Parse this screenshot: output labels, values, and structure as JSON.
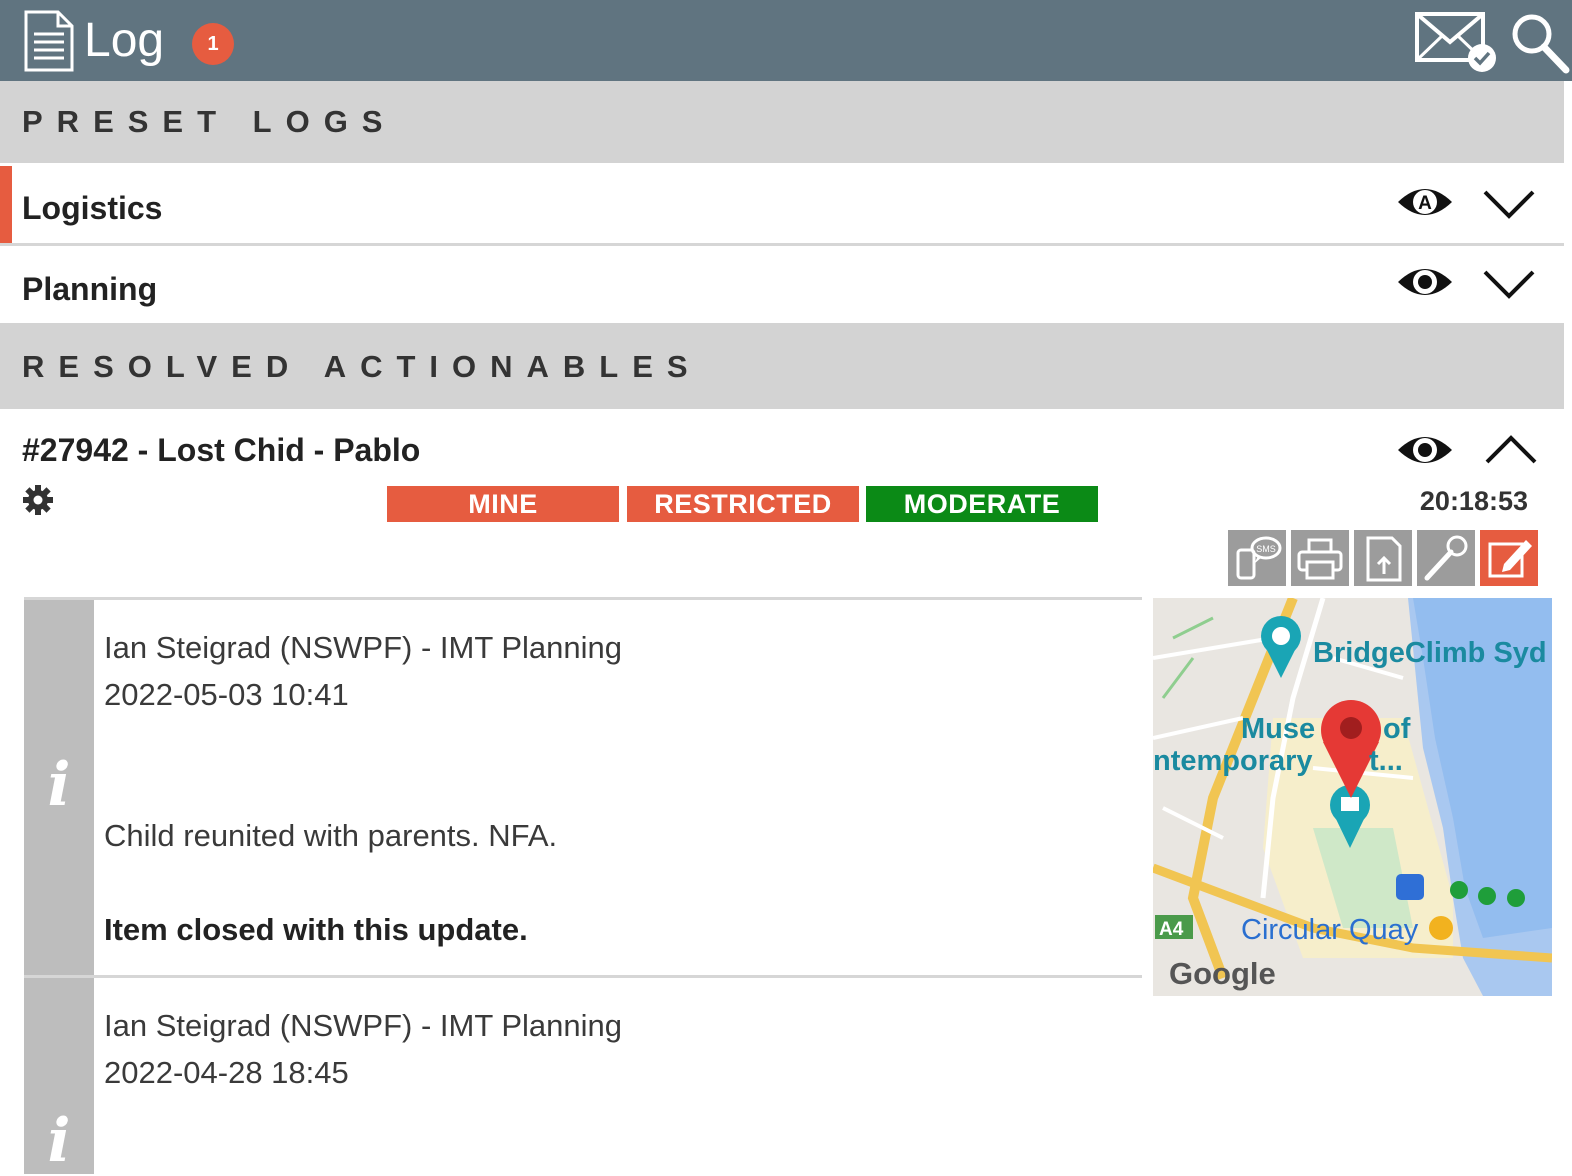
{
  "header": {
    "title": "Log",
    "badge_count": "1",
    "icons": [
      "document-icon",
      "mail-check-icon",
      "search-icon"
    ]
  },
  "preset_logs": {
    "heading": "PRESET LOGS",
    "items": [
      {
        "label": "Logistics",
        "accent": "#e65c40",
        "eye": "eye-a-icon"
      },
      {
        "label": "Planning",
        "eye": "eye-icon"
      }
    ]
  },
  "resolved": {
    "heading": "RESOLVED ACTIONABLES",
    "item": {
      "title": "#27942 - Lost Chid - Pablo",
      "time": "20:18:53",
      "tags": [
        {
          "label": "MINE",
          "color": "#e65c40"
        },
        {
          "label": "RESTRICTED",
          "color": "#e65c40"
        },
        {
          "label": "MODERATE",
          "color": "#0b8a16"
        }
      ],
      "toolbar": [
        "sms-icon",
        "print-icon",
        "attach-document-icon",
        "microphone-icon",
        "edit-icon"
      ],
      "entries": [
        {
          "author": "Ian Steigrad (NSWPF) - IMT Planning",
          "datetime": "2022-05-03 10:41",
          "message": "Child reunited with parents. NFA.",
          "closing": "Item closed with this update."
        },
        {
          "author": "Ian Steigrad (NSWPF) - IMT Planning",
          "datetime": "2022-04-28 18:45"
        }
      ],
      "map": {
        "labels": {
          "bridgeclimb": "BridgeClimb Syd",
          "museum1": "Muse",
          "museum2": "of",
          "museum3": "ntemporary",
          "museum4": "t...",
          "quay": "Circular Quay",
          "road": "A4",
          "google": "Google"
        }
      }
    }
  },
  "colors": {
    "topbar": "#607480",
    "accent": "#e65c40",
    "moderate": "#0b8a16",
    "section_bg": "#d3d3d3"
  }
}
